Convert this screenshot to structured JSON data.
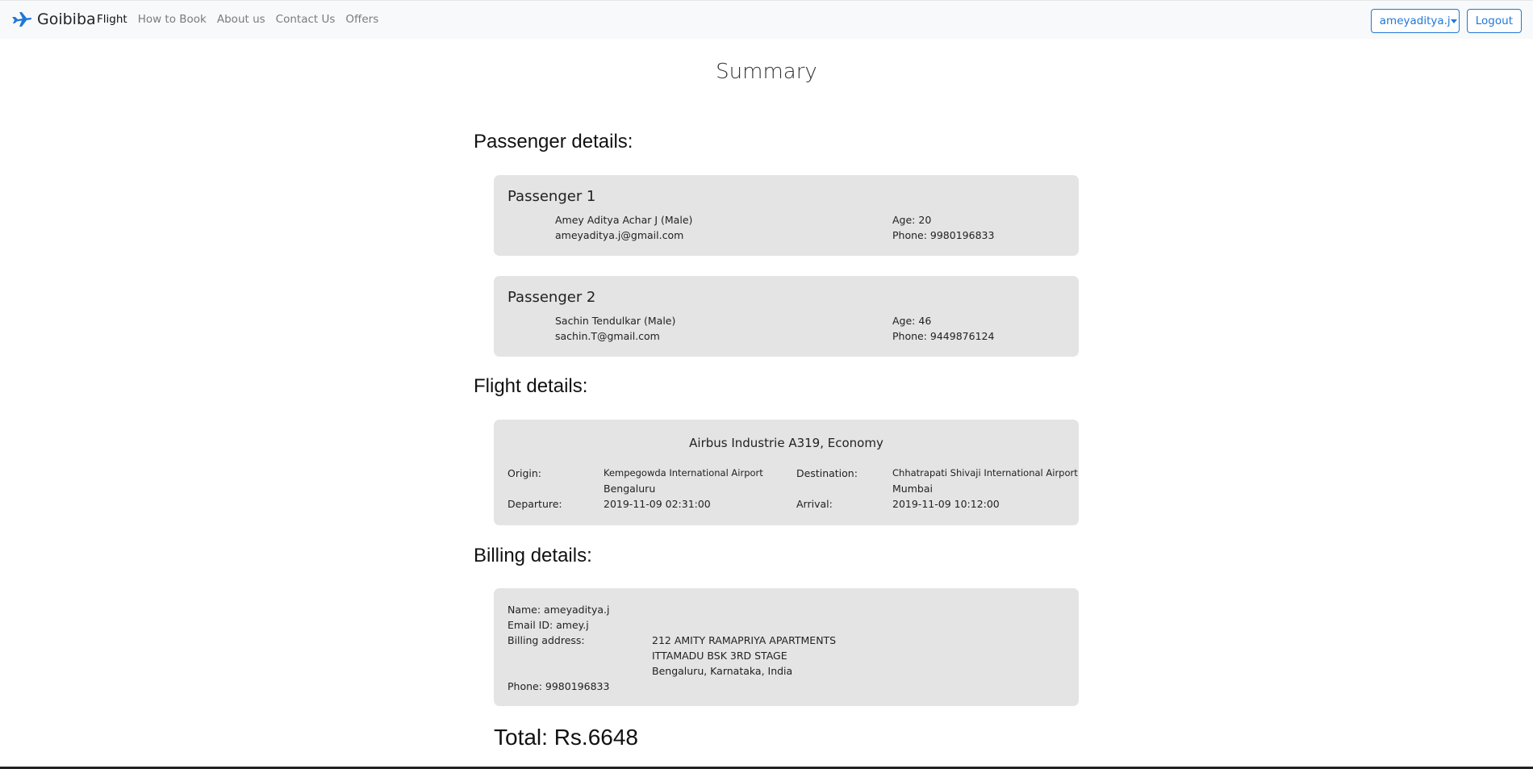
{
  "brand": {
    "name": "Goibiba",
    "icon": "airplane-icon"
  },
  "nav": {
    "links": [
      "Flight",
      "How to Book",
      "About us",
      "Contact Us",
      "Offers"
    ],
    "active": "Flight"
  },
  "user_menu": {
    "username": "ameyaditya.j",
    "logout_label": "Logout"
  },
  "colors": {
    "accent": "#1f78d6",
    "card_bg": "#e4e4e4",
    "navbar_bg": "#f8f9fa"
  },
  "page_title": "Summary",
  "passengers_section": {
    "heading": "Passenger details:",
    "passengers": [
      {
        "title": "Passenger 1",
        "name_gender": "Amey Aditya Achar J (Male)",
        "email": "ameyaditya.j@gmail.com",
        "age": "Age: 20",
        "phone": "Phone: 9980196833"
      },
      {
        "title": "Passenger 2",
        "name_gender": "Sachin Tendulkar (Male)",
        "email": "sachin.T@gmail.com",
        "age": "Age: 46",
        "phone": "Phone: 9449876124"
      }
    ]
  },
  "flight_section": {
    "heading": "Flight details:",
    "aircraft": "Airbus Industrie A319, Economy",
    "origin_label": "Origin:",
    "origin_airport": "Kempegowda International Airport",
    "origin_city": "Bengaluru",
    "destination_label": "Destination:",
    "destination_airport": "Chhatrapati Shivaji International Airport",
    "destination_city": "Mumbai",
    "departure_label": "Departure:",
    "departure_value": "2019-11-09 02:31:00",
    "arrival_label": "Arrival:",
    "arrival_value": "2019-11-09 10:12:00"
  },
  "billing_section": {
    "heading": "Billing details:",
    "name": "Name: ameyaditya.j",
    "email_id": "Email ID: amey.j",
    "address_label": "Billing address:",
    "address_line1": "212 AMITY RAMAPRIYA APARTMENTS",
    "address_line2": "ITTAMADU BSK 3RD STAGE",
    "address_line3": "Bengaluru, Karnataka, India",
    "phone": "Phone: 9980196833"
  },
  "total": "Total: Rs.6648"
}
